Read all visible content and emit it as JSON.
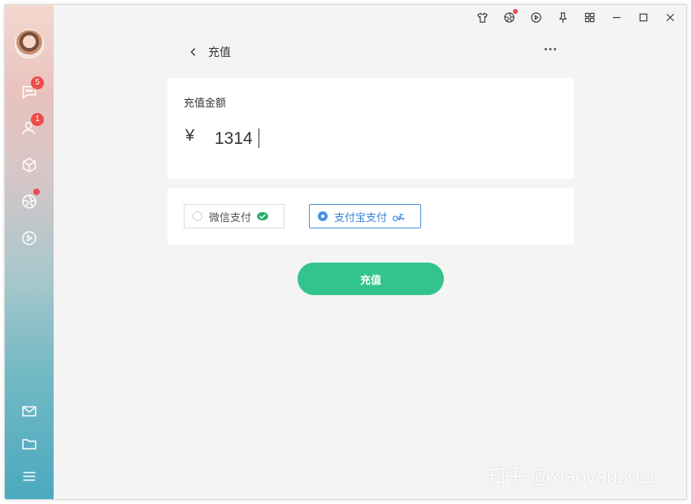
{
  "window": {
    "titlebar_icons": [
      "shirt-icon",
      "aperture-icon",
      "play-circle-icon",
      "pin-icon",
      "grid-icon",
      "minimize-icon",
      "maximize-icon",
      "close-icon"
    ]
  },
  "sidebar": {
    "items": [
      {
        "icon": "chat-icon",
        "badge": "5"
      },
      {
        "icon": "contacts-icon",
        "badge": "1"
      },
      {
        "icon": "cube-icon"
      },
      {
        "icon": "aperture-icon",
        "dot": true
      },
      {
        "icon": "play-circle-icon"
      },
      {
        "icon": "mail-icon"
      },
      {
        "icon": "folder-icon"
      },
      {
        "icon": "menu-icon"
      }
    ]
  },
  "header": {
    "title": "充值"
  },
  "amount": {
    "label": "充值金额",
    "currency": "¥",
    "value": "1314"
  },
  "payment": {
    "options": [
      {
        "label": "微信支付",
        "selected": false,
        "brand_color": "#2aae67"
      },
      {
        "label": "支付宝支付",
        "selected": true,
        "brand_color": "#4a90e2"
      }
    ]
  },
  "actions": {
    "submit_label": "充值",
    "submit_color": "#33c48d"
  },
  "watermark": "知乎 @xiaoyan2021"
}
